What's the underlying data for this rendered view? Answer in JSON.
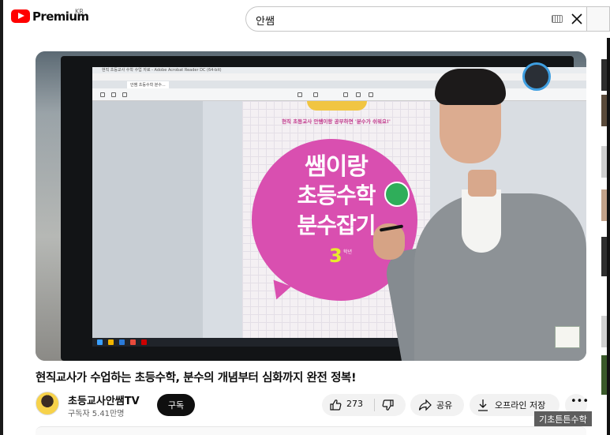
{
  "header": {
    "brand": "Premium",
    "region": "KR",
    "search_value": "안쌤"
  },
  "video": {
    "screen": {
      "window_title": "현직 초등교사 수학 수업 자료 - Adobe Acrobat Reader DC (64-bit)",
      "tab_label": "안쌤 초등수학 분수...",
      "cover_subtitle": "현직 초등교사 안쌤이랑 공부하면 '분수가 쉬워요!'",
      "cover_title_1": "쌤이랑",
      "cover_title_2": "초등수학",
      "cover_title_3": "분수잡기",
      "cover_grade": "3",
      "cover_grade_suffix": "학년"
    }
  },
  "details": {
    "title": "현직교사가 수업하는 초등수학, 분수의 개념부터 심화까지 완전 정복!",
    "channel_name": "초등교사안쌤TV",
    "subscribers": "구독자 5.41만명",
    "subscribe_label": "구독",
    "like_count": "273",
    "share_label": "공유",
    "offline_label": "오프라인 저장",
    "more_label": "•••",
    "tooltip": "기초튼튼수학"
  },
  "colors": {
    "accent": "#ff0000",
    "cover_pink": "#d94fb0",
    "grade_yellow": "#e8ec2b"
  }
}
